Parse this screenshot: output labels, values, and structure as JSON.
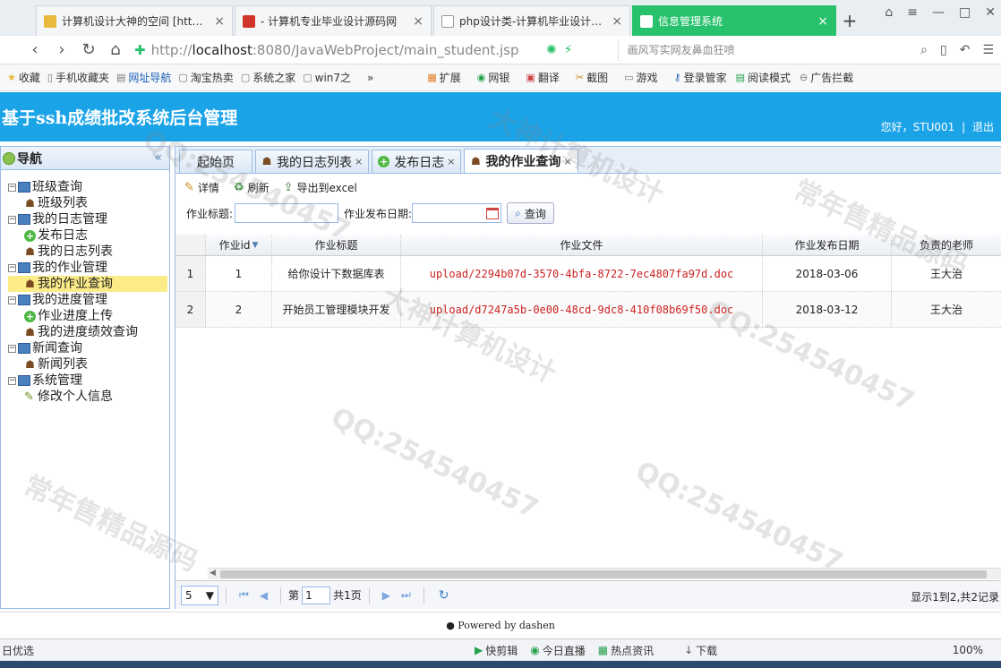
{
  "browser": {
    "tabs": [
      {
        "title": "计算机设计大神的空间 [http://...",
        "fav_color": "#e8b93a",
        "active": false
      },
      {
        "title": "- 计算机专业毕业设计源码网",
        "fav_color": "#d0352b",
        "active": false
      },
      {
        "title": "php设计类-计算机毕业设计源码",
        "fav_color": "#9aa",
        "active": false
      },
      {
        "title": "信息管理系统",
        "fav_color": "#ffffff",
        "active": true
      }
    ],
    "new_tab": "+",
    "url_prefix": "http://",
    "url_host": "localhost",
    "url_rest": ":8080/JavaWebProject/main_student.jsp",
    "search_placeholder": "画风写实网友鼻血狂喷"
  },
  "bookmarks": [
    {
      "label": "收藏",
      "icon": "star-icon"
    },
    {
      "label": "手机收藏夹",
      "icon": "phone-icon"
    },
    {
      "label": "网址导航",
      "icon": "page-icon"
    },
    {
      "label": "淘宝热卖",
      "icon": "page-icon"
    },
    {
      "label": "系统之家",
      "icon": "page-icon"
    },
    {
      "label": "win7之",
      "icon": "page-icon"
    },
    {
      "label": "»",
      "icon": ""
    },
    {
      "label": "扩展",
      "icon": "grid-icon"
    },
    {
      "label": "网银",
      "icon": "bank-icon"
    },
    {
      "label": "翻译",
      "icon": "translate-icon"
    },
    {
      "label": "截图",
      "icon": "scissors-icon"
    },
    {
      "label": "游戏",
      "icon": "gamepad-icon"
    },
    {
      "label": "登录管家",
      "icon": "key-icon"
    },
    {
      "label": "阅读模式",
      "icon": "book-icon"
    },
    {
      "label": "广告拦截",
      "icon": "block-icon"
    }
  ],
  "header": {
    "title": "基于ssh成绩批改系统后台管理",
    "greeting": "您好，STU001",
    "separator": "|",
    "logout": "退出"
  },
  "sidebar": {
    "title": "导航",
    "collapse": "«",
    "groups": [
      {
        "label": "班级查询",
        "items": [
          {
            "label": "班级列表",
            "icon": "user-icon"
          }
        ]
      },
      {
        "label": "我的日志管理",
        "items": [
          {
            "label": "发布日志",
            "icon": "add-icon"
          },
          {
            "label": "我的日志列表",
            "icon": "user-icon"
          }
        ]
      },
      {
        "label": "我的作业管理",
        "items": [
          {
            "label": "我的作业查询",
            "icon": "user-icon",
            "selected": true
          }
        ]
      },
      {
        "label": "我的进度管理",
        "items": [
          {
            "label": "作业进度上传",
            "icon": "add-icon"
          },
          {
            "label": "我的进度绩效查询",
            "icon": "user-icon"
          }
        ]
      },
      {
        "label": "新闻查询",
        "items": [
          {
            "label": "新闻列表",
            "icon": "user-icon"
          }
        ]
      },
      {
        "label": "系统管理",
        "items": [
          {
            "label": "修改个人信息",
            "icon": "pencil-icon"
          }
        ]
      }
    ]
  },
  "main": {
    "tabs": [
      {
        "label": "起始页",
        "icon": "",
        "closable": false,
        "active": false
      },
      {
        "label": "我的日志列表",
        "icon": "user-icon",
        "closable": true,
        "active": false
      },
      {
        "label": "发布日志",
        "icon": "add-icon",
        "closable": true,
        "active": false
      },
      {
        "label": "我的作业查询",
        "icon": "user-icon",
        "closable": true,
        "active": true
      }
    ],
    "toolbar": {
      "detail": "详情",
      "refresh": "刷新",
      "export": "导出到excel"
    },
    "filters": {
      "title_label": "作业标题:",
      "title_value": "",
      "date_label": "作业发布日期:",
      "date_value": "",
      "query": "查询"
    },
    "table": {
      "columns": [
        "作业id",
        "作业标题",
        "作业文件",
        "作业发布日期",
        "负责的老师"
      ],
      "rows": [
        {
          "rownum": "1",
          "id": "1",
          "title": "给你设计下数据库表",
          "file": "upload/2294b07d-3570-4bfa-8722-7ec4807fa97d.doc",
          "date": "2018-03-06",
          "teacher": "王大治"
        },
        {
          "rownum": "2",
          "id": "2",
          "title": "开始员工管理模块开发",
          "file": "upload/d7247a5b-0e00-48cd-9dc8-410f08b69f50.doc",
          "date": "2018-03-12",
          "teacher": "王大治"
        }
      ]
    },
    "pager": {
      "page_size": "5",
      "page_prefix": "第",
      "page_number": "1",
      "page_suffix": "共1页",
      "info": "显示1到2,共2记录"
    }
  },
  "footer": {
    "text": "Powered by dashen"
  },
  "statusbar": {
    "left": "日优选",
    "items": [
      "快剪辑",
      "今日直播",
      "热点资讯",
      "下载"
    ],
    "zoom": "100%"
  },
  "watermarks": [
    "QQ:254540457",
    "大神计算机设计",
    "常年售精品源码"
  ]
}
